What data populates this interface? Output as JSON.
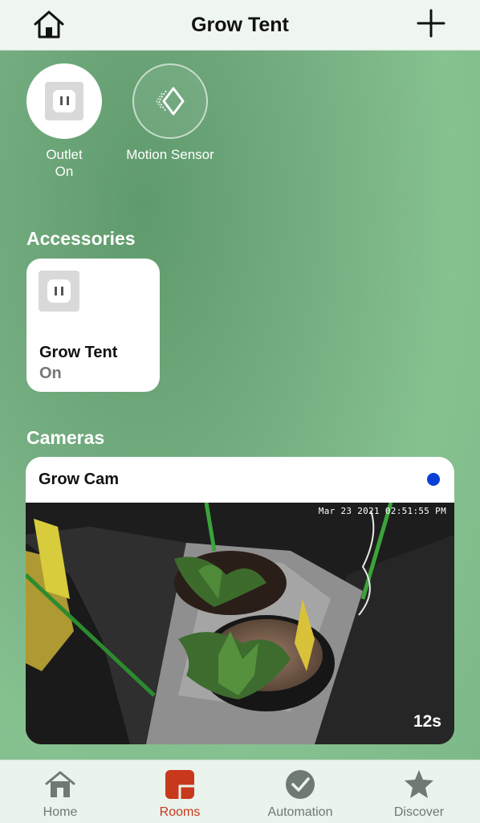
{
  "header": {
    "title": "Grow Tent"
  },
  "quick_tiles": [
    {
      "label_line1": "Outlet",
      "label_line2": "On"
    },
    {
      "label_line1": "Motion Sensor",
      "label_line2": ""
    }
  ],
  "accessories": {
    "section_title": "Accessories",
    "items": [
      {
        "name": "Grow Tent",
        "state": "On"
      }
    ]
  },
  "cameras": {
    "section_title": "Cameras",
    "items": [
      {
        "name": "Grow Cam",
        "timestamp": "Mar 23 2021  02:51:55 PM",
        "age": "12s"
      }
    ]
  },
  "tabs": [
    {
      "label": "Home",
      "icon": "house-icon"
    },
    {
      "label": "Rooms",
      "icon": "rooms-icon",
      "active": true
    },
    {
      "label": "Automation",
      "icon": "clock-check-icon"
    },
    {
      "label": "Discover",
      "icon": "star-icon"
    }
  ],
  "colors": {
    "accent": "#c8381c",
    "live_dot": "#0a3fd8",
    "header_bg": "#eef6ef"
  }
}
